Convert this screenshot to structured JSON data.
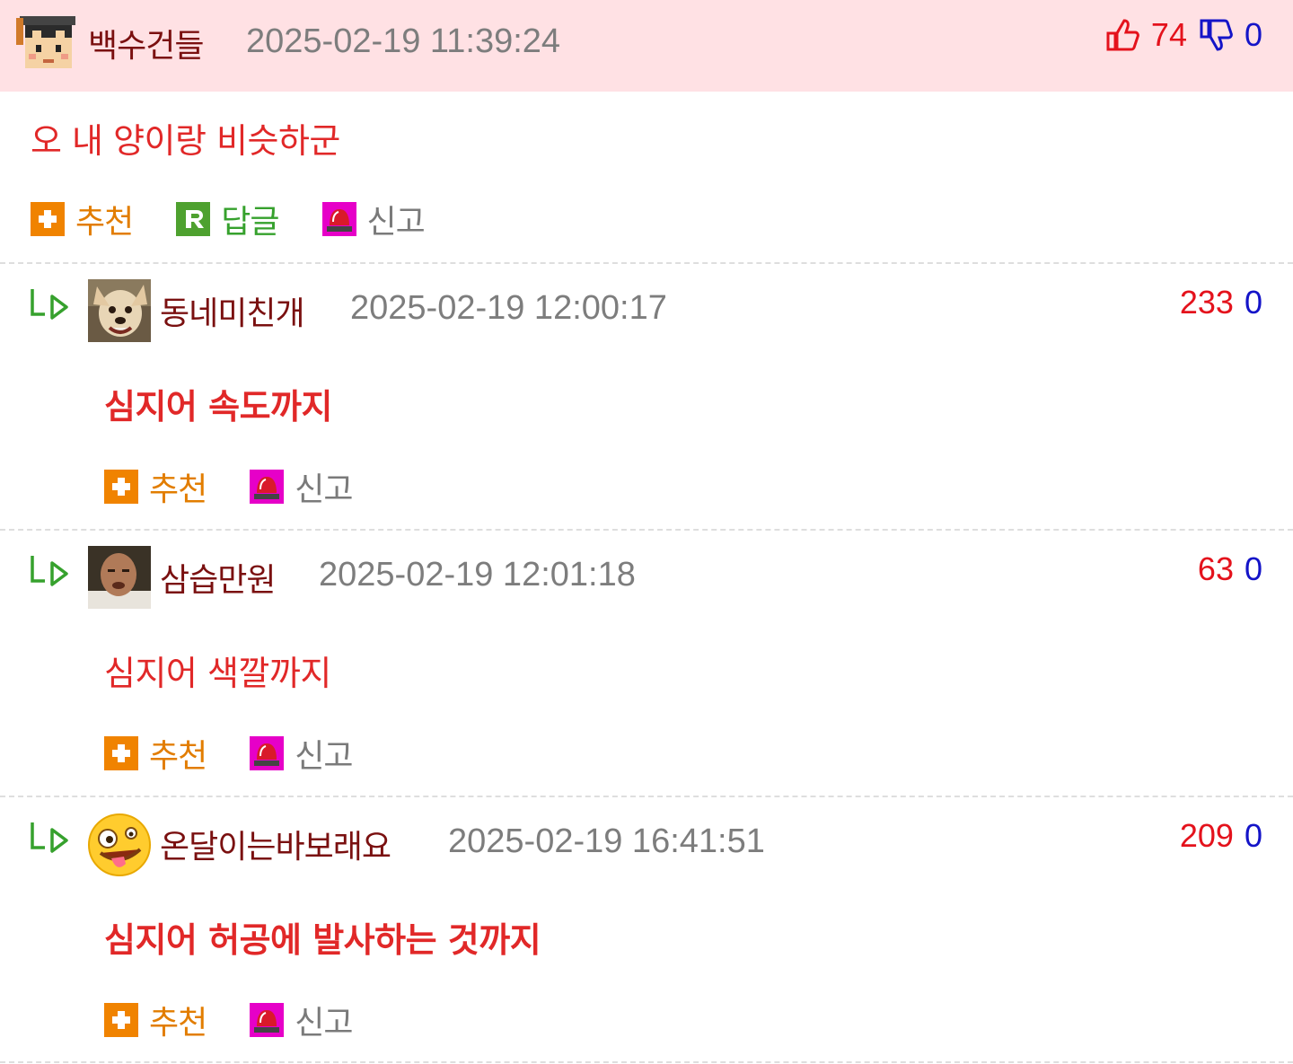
{
  "comments": [
    {
      "nick": "백수건들",
      "date": "2025-02-19 11:39:24",
      "up": "74",
      "down": "0",
      "body": "오 내 양이랑 비슷하군",
      "recommend": "추천",
      "reply": "답글",
      "report": "신고"
    },
    {
      "nick": "동네미친개",
      "date": "2025-02-19 12:00:17",
      "up": "233",
      "down": "0",
      "body": "심지어 속도까지",
      "recommend": "추천",
      "report": "신고"
    },
    {
      "nick": "삼습만원",
      "date": "2025-02-19 12:01:18",
      "up": "63",
      "down": "0",
      "body": "심지어 색깔까지",
      "recommend": "추천",
      "report": "신고"
    },
    {
      "nick": "온달이는바보래요",
      "date": "2025-02-19 16:41:51",
      "up": "209",
      "down": "0",
      "body": "심지어 허공에 발사하는 것까지",
      "recommend": "추천",
      "report": "신고"
    }
  ],
  "icons": {
    "best_avatar": "graduate-cap-avatar-icon",
    "thumb_up": "thumb-up-icon",
    "thumb_down": "thumb-down-icon",
    "recommend": "plus-icon",
    "reply": "r-icon",
    "report": "siren-icon",
    "reply_arrow": "reply-arrow-icon"
  },
  "colors": {
    "best_bg": "#ffe1e4",
    "up": "#e4121c",
    "down": "#1414c8",
    "recommend": "#e27d00",
    "reply": "#36a12d",
    "report_icon": "#e600c8",
    "body_text": "#e12828",
    "nick": "#7a1010"
  }
}
